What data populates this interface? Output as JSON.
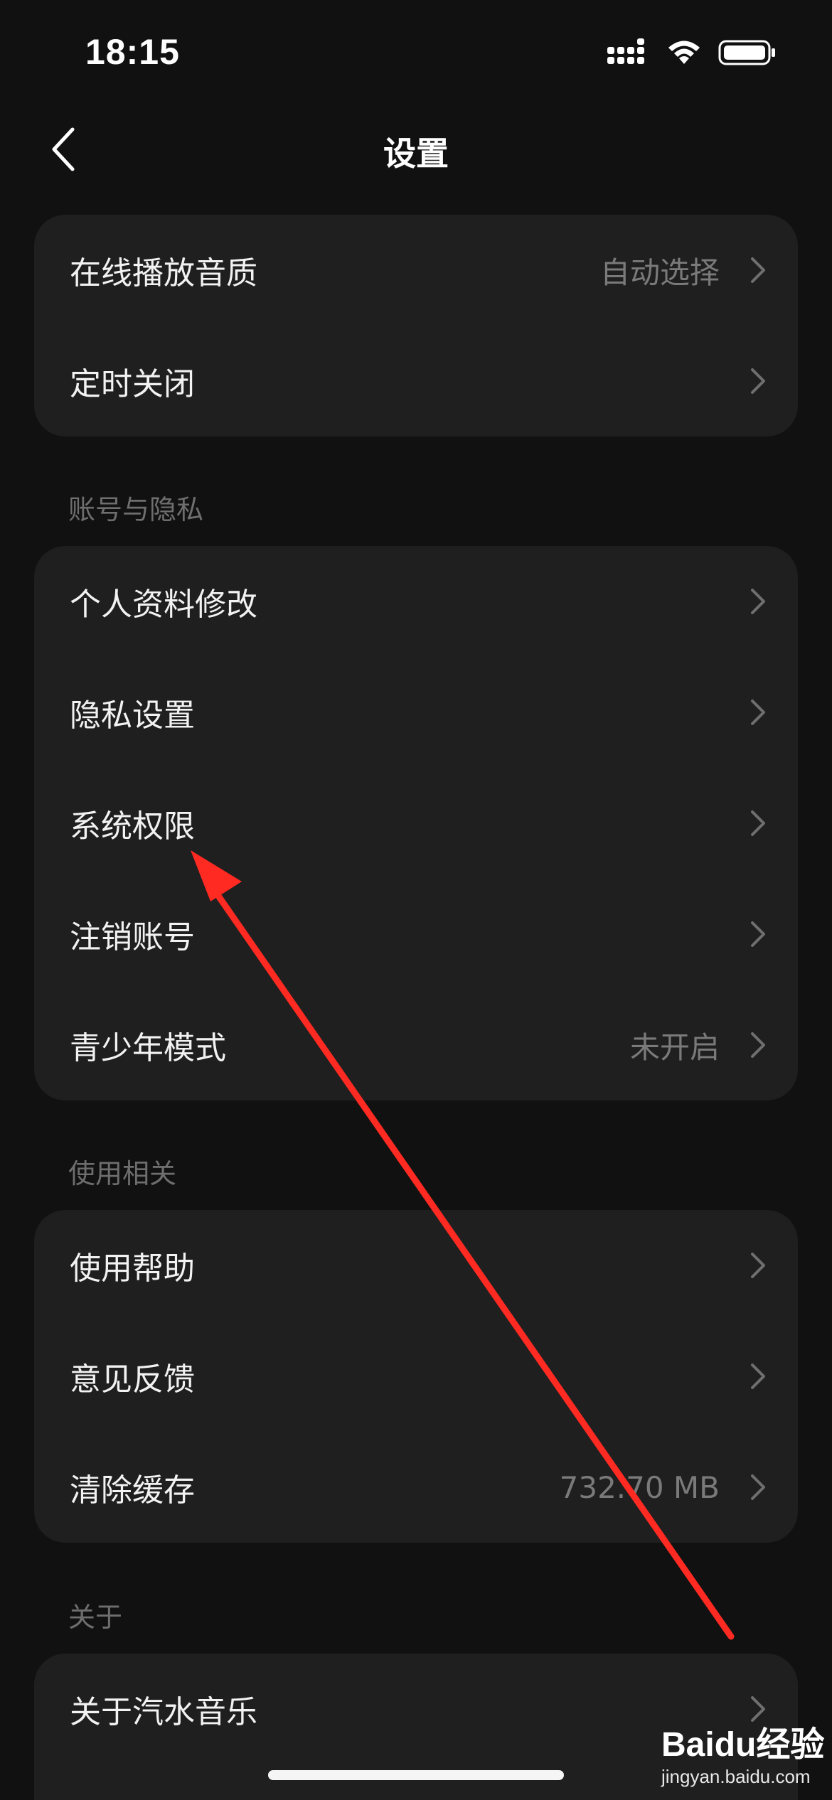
{
  "status_bar": {
    "time": "18:15",
    "icons": [
      "signal-icon",
      "wifi-icon",
      "battery-icon"
    ]
  },
  "nav": {
    "title": "设置",
    "back_icon": "chevron-left-icon"
  },
  "groups": {
    "playback": {
      "items": [
        {
          "label": "在线播放音质",
          "value": "自动选择"
        },
        {
          "label": "定时关闭",
          "value": ""
        }
      ]
    },
    "account": {
      "header": "账号与隐私",
      "items": [
        {
          "label": "个人资料修改",
          "value": ""
        },
        {
          "label": "隐私设置",
          "value": ""
        },
        {
          "label": "系统权限",
          "value": ""
        },
        {
          "label": "注销账号",
          "value": ""
        },
        {
          "label": "青少年模式",
          "value": "未开启"
        }
      ]
    },
    "usage": {
      "header": "使用相关",
      "items": [
        {
          "label": "使用帮助",
          "value": ""
        },
        {
          "label": "意见反馈",
          "value": ""
        },
        {
          "label": "清除缓存",
          "value": "732.70 MB"
        }
      ]
    },
    "about": {
      "header": "关于",
      "items": [
        {
          "label": "关于汽水音乐",
          "value": ""
        }
      ]
    }
  },
  "annotation": {
    "color": "#ff2a22"
  },
  "watermark": {
    "main": "Baidu经验",
    "sub": "jingyan.baidu.com"
  },
  "colors": {
    "background": "#111111",
    "card": "#1f1f1f",
    "text": "#f2f2f2",
    "secondary": "#7a7a7a"
  }
}
